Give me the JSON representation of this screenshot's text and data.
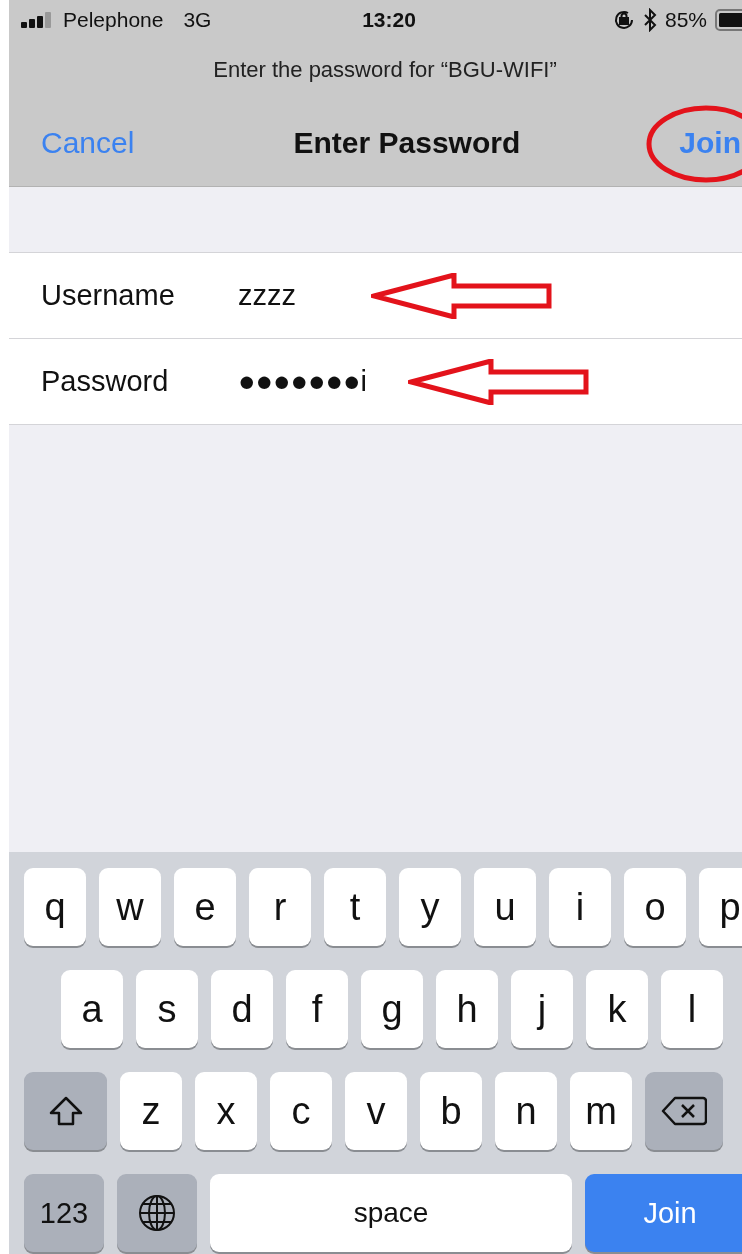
{
  "status_bar": {
    "carrier": "Pelephone",
    "network": "3G",
    "time": "13:20",
    "battery": "85%"
  },
  "prompt": "Enter the password for “BGU-WIFI”",
  "nav": {
    "cancel": "Cancel",
    "title": "Enter Password",
    "join": "Join"
  },
  "fields": [
    {
      "label": "Username",
      "value": "zzzz"
    },
    {
      "label": "Password",
      "value": "●●●●●●●i"
    }
  ],
  "keyboard": {
    "rows": [
      {
        "keys": [
          {
            "kind": "letter",
            "label": "q"
          },
          {
            "kind": "letter",
            "label": "w"
          },
          {
            "kind": "letter",
            "label": "e"
          },
          {
            "kind": "letter",
            "label": "r"
          },
          {
            "kind": "letter",
            "label": "t"
          },
          {
            "kind": "letter",
            "label": "y"
          },
          {
            "kind": "letter",
            "label": "u"
          },
          {
            "kind": "letter",
            "label": "i"
          },
          {
            "kind": "letter",
            "label": "o"
          },
          {
            "kind": "letter",
            "label": "p"
          }
        ]
      },
      {
        "keys": [
          {
            "kind": "letter",
            "label": "a"
          },
          {
            "kind": "letter",
            "label": "s"
          },
          {
            "kind": "letter",
            "label": "d"
          },
          {
            "kind": "letter",
            "label": "f"
          },
          {
            "kind": "letter",
            "label": "g"
          },
          {
            "kind": "letter",
            "label": "h"
          },
          {
            "kind": "letter",
            "label": "j"
          },
          {
            "kind": "letter",
            "label": "k"
          },
          {
            "kind": "letter",
            "label": "l"
          }
        ]
      },
      {
        "keys": [
          {
            "kind": "shift"
          },
          {
            "kind": "letter",
            "label": "z"
          },
          {
            "kind": "letter",
            "label": "x"
          },
          {
            "kind": "letter",
            "label": "c"
          },
          {
            "kind": "letter",
            "label": "v"
          },
          {
            "kind": "letter",
            "label": "b"
          },
          {
            "kind": "letter",
            "label": "n"
          },
          {
            "kind": "letter",
            "label": "m"
          },
          {
            "kind": "backspace"
          }
        ]
      },
      {
        "keys": [
          {
            "kind": "numbers",
            "label": "123"
          },
          {
            "kind": "globe"
          },
          {
            "kind": "space",
            "label": "space"
          },
          {
            "kind": "action",
            "label": "Join"
          }
        ]
      }
    ]
  }
}
